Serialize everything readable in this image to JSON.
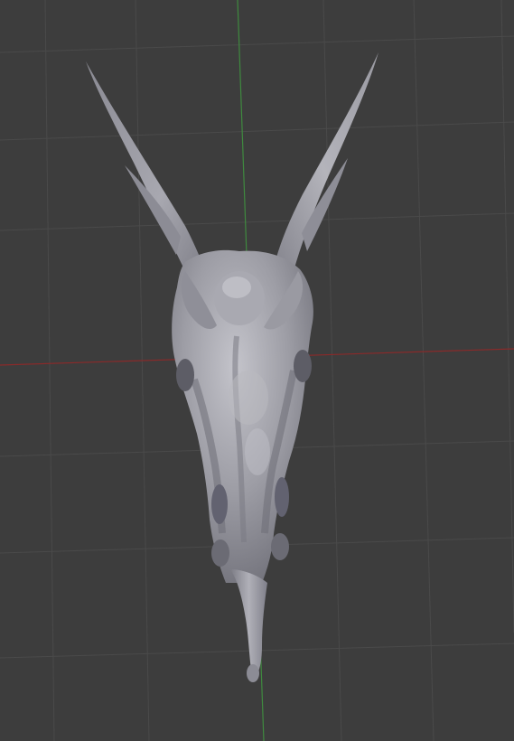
{
  "viewport": {
    "view": "3d-viewport",
    "background_color": "#3d3d3d",
    "grid": {
      "visible": true,
      "line_color": "#4a4a4a",
      "x_axis_color": "#8a2a2a",
      "y_axis_color": "#3f8a3f"
    },
    "object": {
      "type": "sculpt-mesh",
      "depicts": "horned-creature-skull",
      "material_color": "#9c9ca4",
      "shadow_color": "#5a5a63",
      "highlight_color": "#c7c7ce"
    }
  }
}
